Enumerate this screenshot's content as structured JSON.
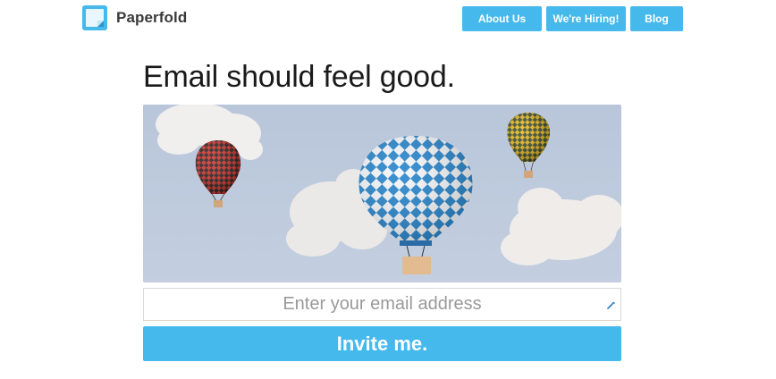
{
  "brand": {
    "name": "Paperfold",
    "icon": "paperfold-logo-icon"
  },
  "nav": {
    "about": "About Us",
    "hiring": "We're Hiring!",
    "blog": "Blog"
  },
  "hero": {
    "headline": "Email should feel good."
  },
  "signup": {
    "email_placeholder": "Enter your email address",
    "email_value": "",
    "submit_label": "Invite me."
  },
  "colors": {
    "accent": "#45b8ec",
    "sky": "#bcc9dc",
    "text": "#1a1a1a"
  }
}
